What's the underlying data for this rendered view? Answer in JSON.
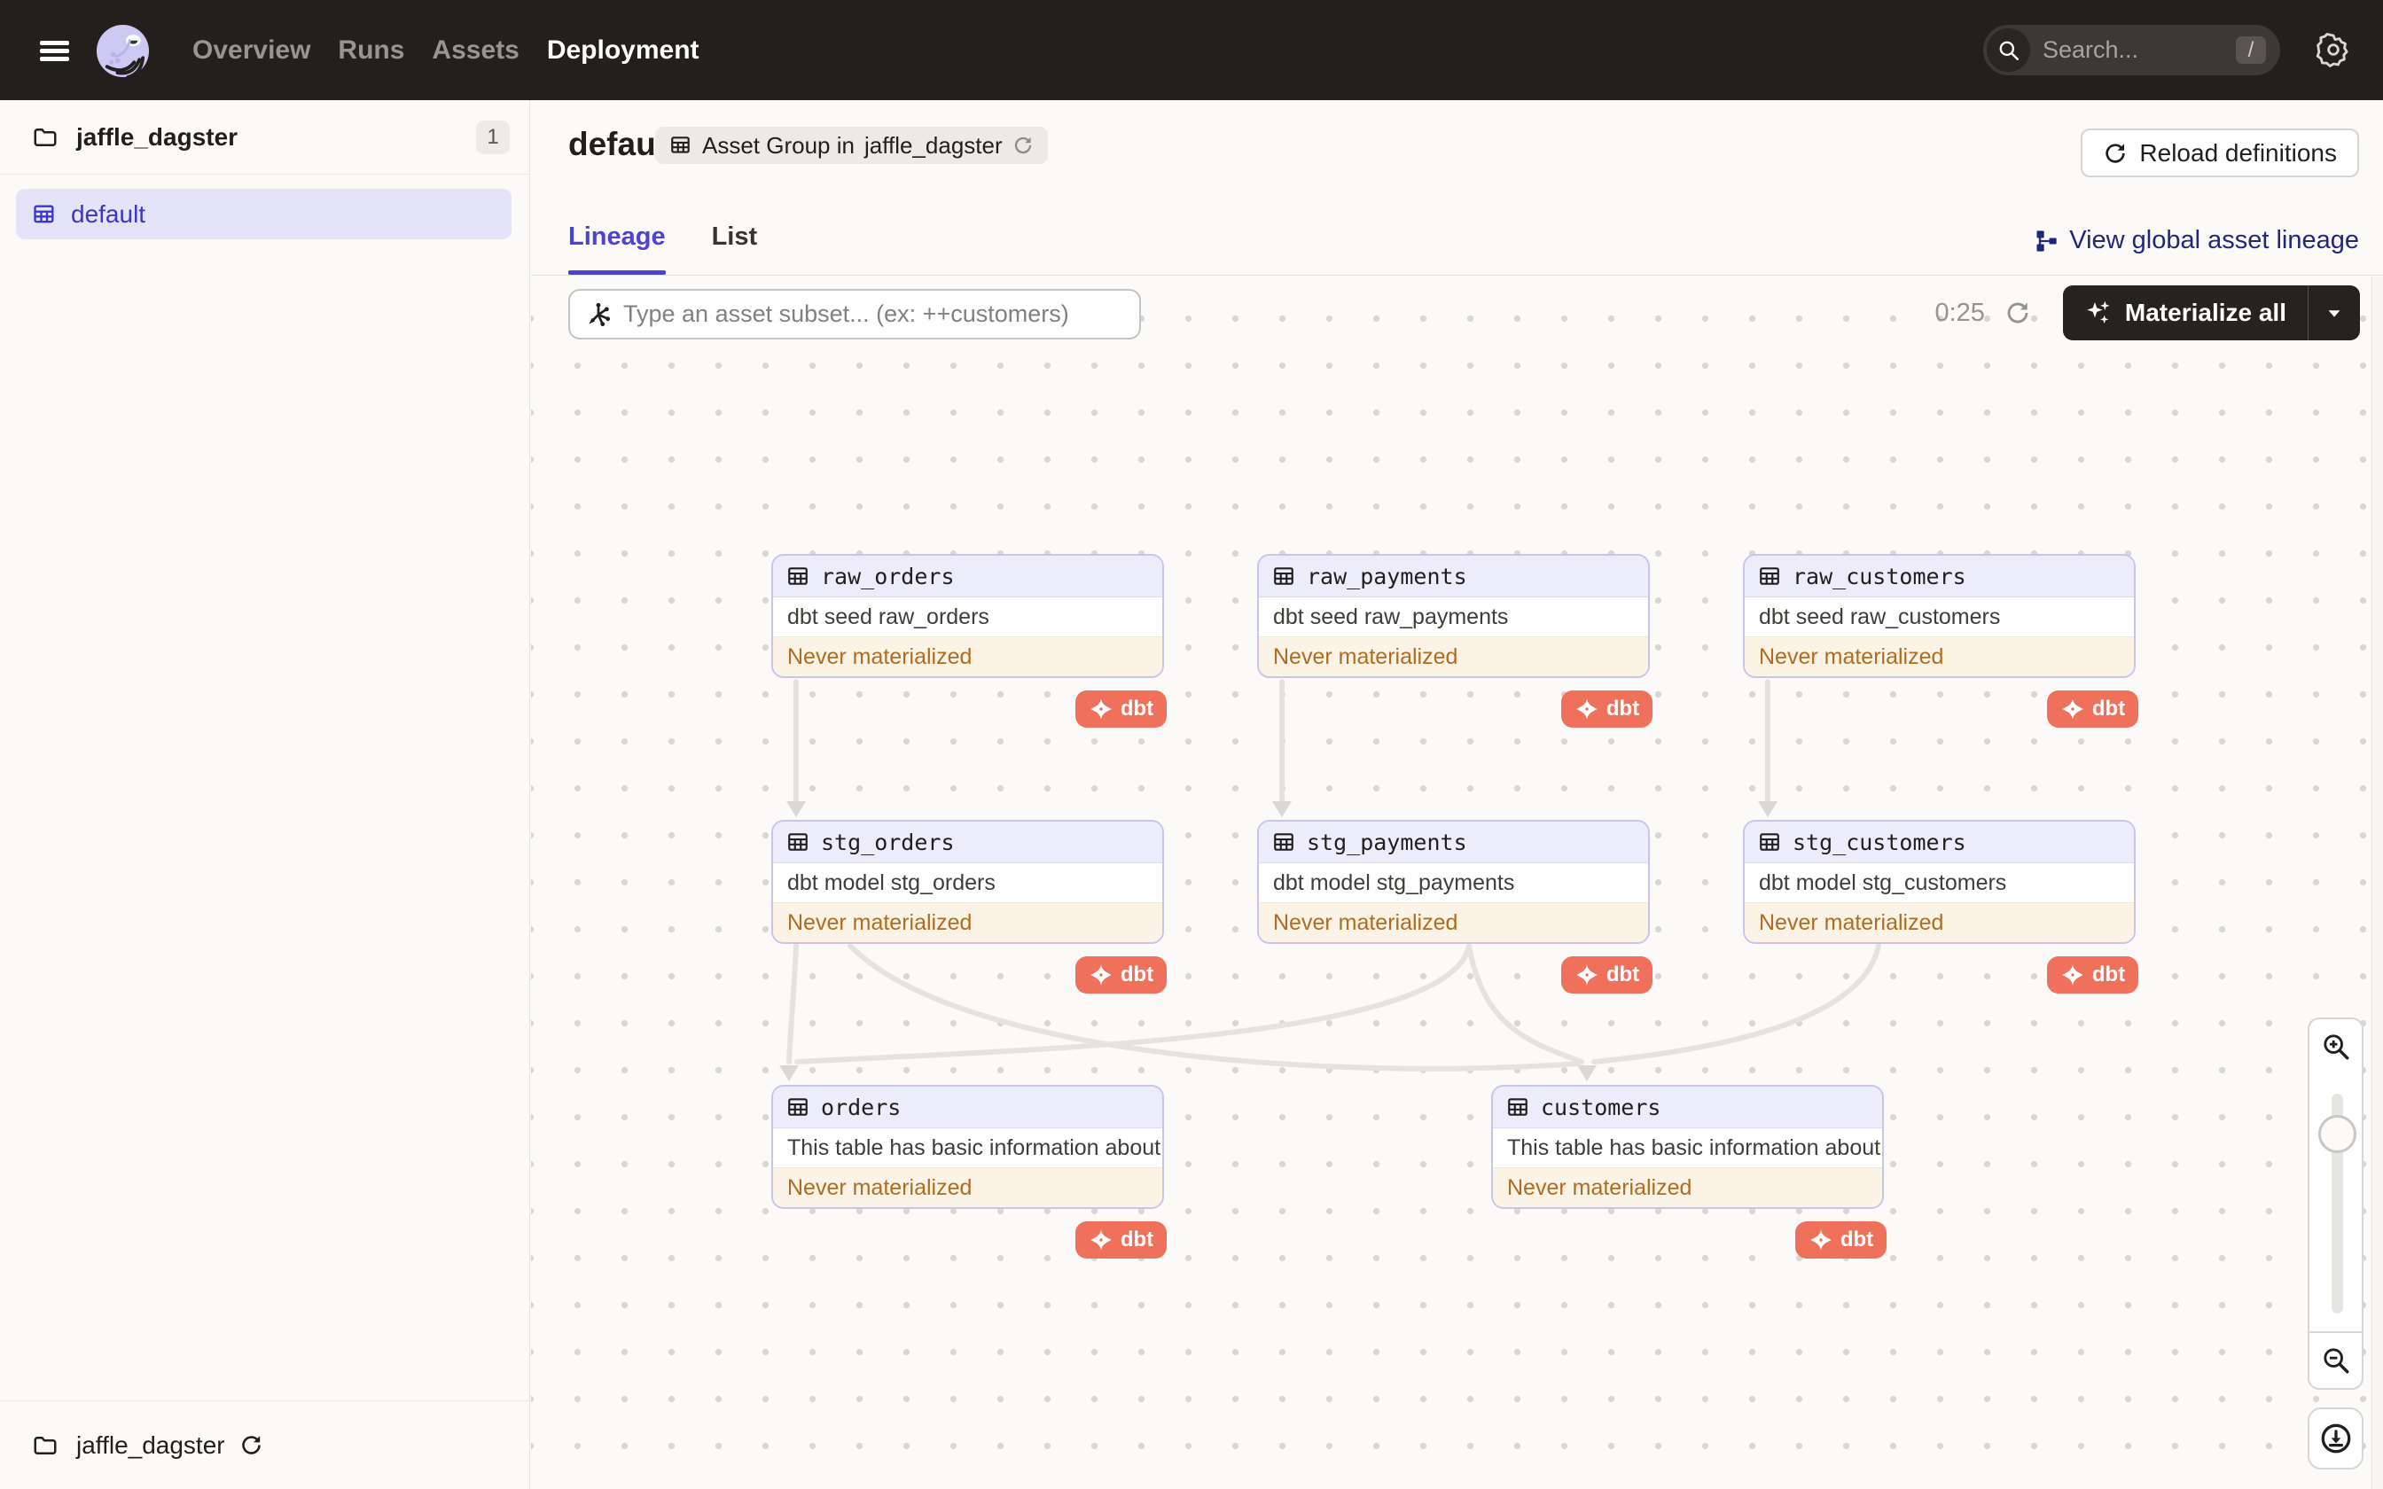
{
  "colors": {
    "nav_bg": "#231f1d",
    "accent_tab": "#4a43d6",
    "link_blue": "#2e2bb0",
    "navy_link": "#222879",
    "selected_row_bg": "#e5e3f7",
    "node_border": "#c8c4ee",
    "status_bg": "#faf3e6",
    "status_text": "#b06c20",
    "dbt_badge_bg": "#ef705b"
  },
  "nav": {
    "items": [
      {
        "label": "Overview"
      },
      {
        "label": "Runs"
      },
      {
        "label": "Assets"
      },
      {
        "label": "Deployment"
      }
    ],
    "search": {
      "placeholder": "Search...",
      "shortcut": "/"
    }
  },
  "sidebar": {
    "repo": {
      "name": "jaffle_dagster",
      "count": "1"
    },
    "groups": [
      {
        "name": "default"
      }
    ],
    "footer": {
      "repo": "jaffle_dagster"
    }
  },
  "header": {
    "title": "default",
    "subtitle": {
      "prefix": "Asset Group in",
      "link": "jaffle_dagster"
    },
    "reload_button": "Reload definitions"
  },
  "tabs": {
    "items": [
      {
        "label": "Lineage"
      },
      {
        "label": "List"
      }
    ],
    "global_lineage_link": "View global asset lineage"
  },
  "toolbar": {
    "filter_placeholder": "Type an asset subset... (ex: ++customers)",
    "timer": "0:25",
    "materialize_button": "Materialize all"
  },
  "graph": {
    "status_label": "Never materialized",
    "dbt_label": "dbt",
    "nodes": [
      {
        "name": "raw_orders",
        "description": "dbt seed raw_orders"
      },
      {
        "name": "raw_payments",
        "description": "dbt seed raw_payments"
      },
      {
        "name": "raw_customers",
        "description": "dbt seed raw_customers"
      },
      {
        "name": "stg_orders",
        "description": "dbt model stg_orders"
      },
      {
        "name": "stg_payments",
        "description": "dbt model stg_payments"
      },
      {
        "name": "stg_customers",
        "description": "dbt model stg_customers"
      },
      {
        "name": "orders",
        "description": "This table has basic information about ..."
      },
      {
        "name": "customers",
        "description": "This table has basic information about ..."
      }
    ]
  }
}
